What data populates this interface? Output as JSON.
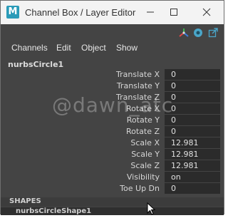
{
  "window": {
    "title": "Channel Box / Layer Editor",
    "app_icon_letter": "M"
  },
  "menu": [
    "Channels",
    "Edit",
    "Object",
    "Show"
  ],
  "node": {
    "name": "nurbsCircle1",
    "attributes": [
      {
        "label": "Translate X",
        "value": "0"
      },
      {
        "label": "Translate Y",
        "value": "0"
      },
      {
        "label": "Translate Z",
        "value": "0"
      },
      {
        "label": "Rotate X",
        "value": "0"
      },
      {
        "label": "Rotate Y",
        "value": "0"
      },
      {
        "label": "Rotate Z",
        "value": "0"
      },
      {
        "label": "Scale X",
        "value": "12.981"
      },
      {
        "label": "Scale Y",
        "value": "12.981"
      },
      {
        "label": "Scale Z",
        "value": "12.981"
      },
      {
        "label": "Visibility",
        "value": "on"
      },
      {
        "label": "Toe Up Dn",
        "value": "0"
      }
    ]
  },
  "shapes": {
    "header": "SHAPES",
    "items": [
      "nurbsCircleShape1"
    ]
  },
  "watermark": "@dawn_atc",
  "colors": {
    "panel_bg": "#444444",
    "field_bg": "#2b2b2b",
    "titlebar_bg": "#f3f3f3",
    "app_icon": "#2a9bb8"
  },
  "icons": [
    "move-tool-icon",
    "camera-icon",
    "external-link-icon"
  ]
}
